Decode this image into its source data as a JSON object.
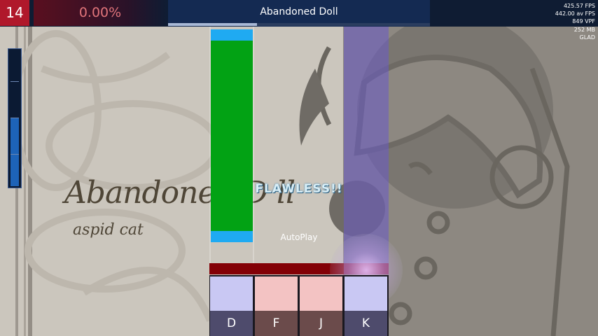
{
  "hud": {
    "combo": "14",
    "accuracy": "0.00%",
    "song_title": "Abandoned Doll",
    "song_progress": 0.34,
    "stats": [
      "425.57 FPS",
      "442.00 av FPS",
      "849 VPF",
      "252 MB",
      "GLAD"
    ]
  },
  "health": {
    "level": 0.5
  },
  "background": {
    "title_art": "Abandoned D  ll",
    "artist_art": "aspid cat"
  },
  "playfield": {
    "judgement": "FLAWLESS!!",
    "autoplay_label": "AutoPlay"
  },
  "keys": [
    {
      "label": "D",
      "top_color": "#c9c8f3",
      "bottom_color": "#4e4b6c"
    },
    {
      "label": "F",
      "top_color": "#f3c3c3",
      "bottom_color": "#6b4b4b"
    },
    {
      "label": "J",
      "top_color": "#f3c3c3",
      "bottom_color": "#6b4b4b"
    },
    {
      "label": "K",
      "top_color": "#c9c8f3",
      "bottom_color": "#4e4b6c"
    }
  ],
  "colors": {
    "combo_bg": "#b0182b",
    "hold_note": "#02a214",
    "hold_cap": "#1faaf2",
    "judge_line": "#830006"
  }
}
